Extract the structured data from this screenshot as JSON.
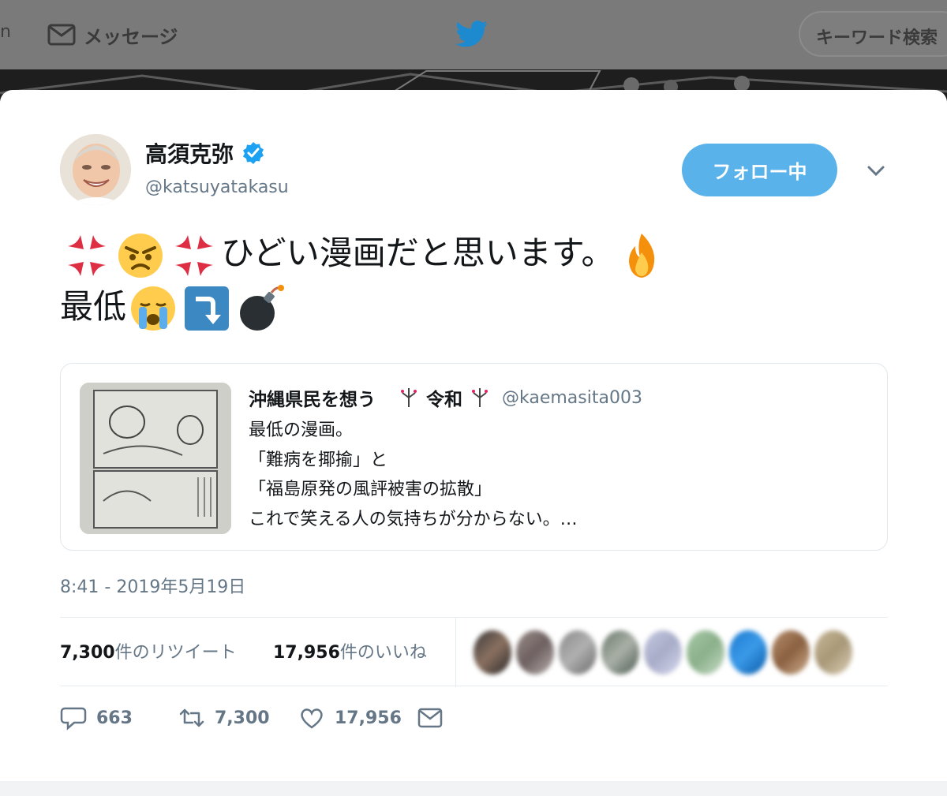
{
  "nav": {
    "messages_label": "メッセージ",
    "search_placeholder": "キーワード検索",
    "edge_glyph": "n"
  },
  "tweet": {
    "display_name": "高須克弥",
    "handle": "@katsuyatakasu",
    "follow_label": "フォロー中",
    "text_line1": "ひどい漫画だと思います。",
    "text_line2": "最低",
    "timestamp": "8:41 - 2019年5月19日",
    "emojis": [
      "anger-icon",
      "angry-face-icon",
      "anger-icon",
      "fire-icon",
      "crying-face-icon",
      "arrow-down-icon",
      "bomb-icon"
    ]
  },
  "quote": {
    "name_part1": "沖縄県民を想う",
    "name_part2": "令和",
    "handle": "@kaemasita003",
    "lines": [
      "最低の漫画。",
      "「難病を揶揄」と",
      "「福島原発の風評被害の拡散」",
      "これで笑える人の気持ちが分からない。…"
    ]
  },
  "stats": {
    "retweet_count": "7,300",
    "retweet_label": "件のリツイート",
    "like_count": "17,956",
    "like_label": "件のいいね"
  },
  "actions": {
    "reply": "663",
    "retweet": "7,300",
    "like": "17,956"
  },
  "colors": {
    "accent": "#1da1f2",
    "follow_button": "#5ab2eb",
    "secondary_text": "#657786"
  }
}
